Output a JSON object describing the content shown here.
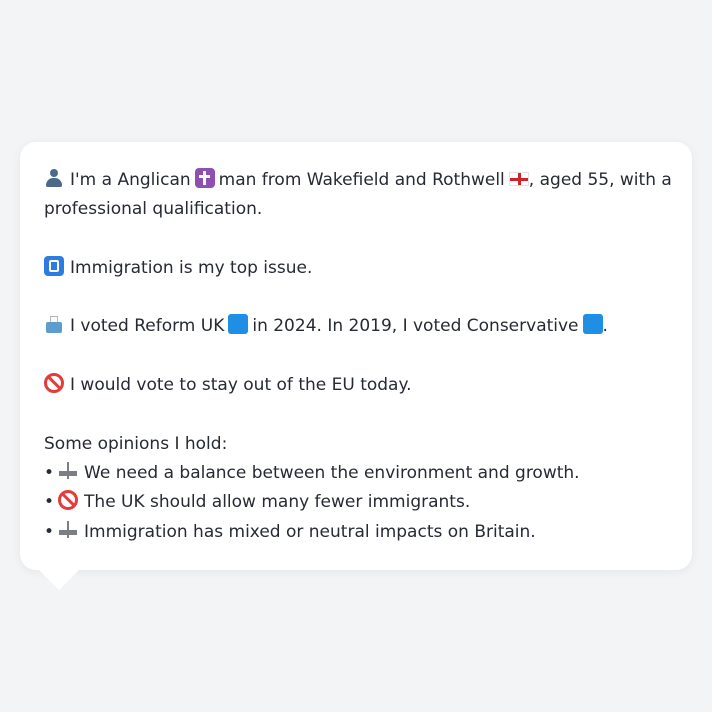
{
  "profile": {
    "line1_a": "I'm a Anglican",
    "line1_b": "man from Wakefield and Rothwell",
    "line1_c": ", aged 55, with a",
    "line1_d": "professional qualification.",
    "top_issue": "Immigration is my top issue.",
    "vote_a": "I voted Reform UK",
    "vote_b": "in 2024. In 2019, I voted Conservative",
    "vote_c": ".",
    "eu": "I would vote to stay out of the EU today.",
    "opinions_heading": "Some opinions I hold:",
    "opinions": [
      {
        "bullet": "•",
        "icon": "balance-scale-icon",
        "text": "We need a balance between the environment and growth."
      },
      {
        "bullet": "•",
        "icon": "prohibited-icon",
        "text": "The UK should allow many fewer immigrants."
      },
      {
        "bullet": "•",
        "icon": "balance-scale-icon",
        "text": "Immigration has mixed or neutral impacts on Britain."
      }
    ]
  },
  "icons": {
    "person": "person-icon",
    "religion": "cross-icon",
    "flag": "england-flag-icon",
    "issue": "passport-control-icon",
    "ballot": "ballot-box-icon",
    "party": "blue-square-icon",
    "eu": "prohibited-icon"
  },
  "colors": {
    "background": "#f3f4f6",
    "bubble": "#ffffff",
    "text": "#262a33"
  }
}
